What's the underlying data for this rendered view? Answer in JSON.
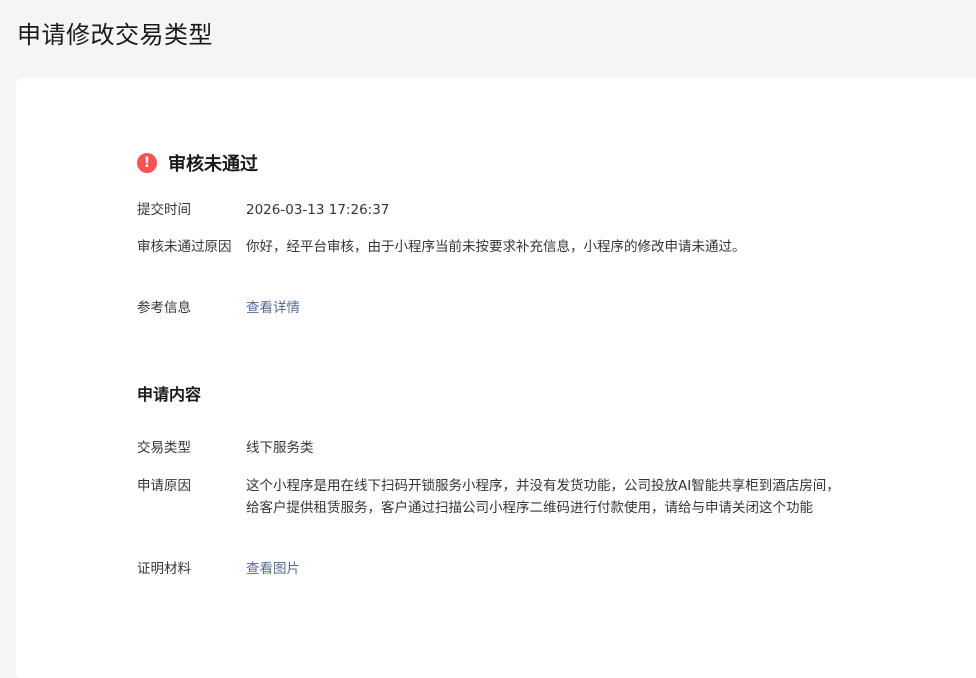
{
  "page": {
    "title": "申请修改交易类型"
  },
  "status": {
    "icon": "exclamation-icon",
    "text": "审核未通过",
    "color": "#fa5151"
  },
  "review": {
    "submit_time_label": "提交时间",
    "submit_time_value": "2026-03-13 17:26:37",
    "reason_label": "审核未通过原因",
    "reason_value": "你好，经平台审核，由于小程序当前未按要求补充信息，小程序的修改申请未通过。",
    "reference_label": "参考信息",
    "reference_link": "查看详情"
  },
  "application": {
    "section_title": "申请内容",
    "trade_type_label": "交易类型",
    "trade_type_value": "线下服务类",
    "apply_reason_label": "申请原因",
    "apply_reason_value": "这个小程序是用在线下扫码开锁服务小程序，并没有发货功能，公司投放AI智能共享柜到酒店房间，给客户提供租赁服务，客户通过扫描公司小程序二维码进行付款使用，请给与申请关闭这个功能",
    "material_label": "证明材料",
    "material_link": "查看图片"
  },
  "colors": {
    "link": "#576b95",
    "background": "#f4f5f7",
    "card": "#ffffff"
  }
}
